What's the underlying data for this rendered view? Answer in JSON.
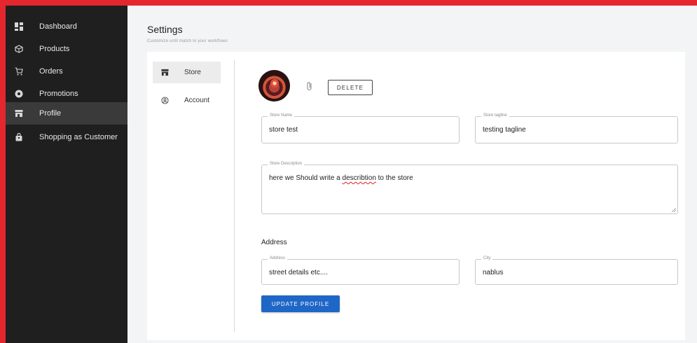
{
  "sidebar": {
    "items": [
      {
        "label": "Dashboard",
        "icon": "dashboard-icon"
      },
      {
        "label": "Products",
        "icon": "box-icon"
      },
      {
        "label": "Orders",
        "icon": "cart-icon"
      },
      {
        "label": "Promotions",
        "icon": "gear-icon"
      },
      {
        "label": "Profile",
        "icon": "store-icon",
        "active": true
      },
      {
        "label": "Shopping as Customer",
        "icon": "bag-icon"
      }
    ]
  },
  "header": {
    "title": "Settings",
    "subtitle": "Customize until match to your workflows"
  },
  "tabs": [
    {
      "label": "Store",
      "icon": "store-icon",
      "active": true
    },
    {
      "label": "Account",
      "icon": "account-icon"
    }
  ],
  "store_form": {
    "delete_label": "DELETE",
    "store_name": {
      "label": "Store Name",
      "value": "store test"
    },
    "store_tagline": {
      "label": "Store tagline",
      "value": "testing tagline"
    },
    "store_description": {
      "label": "Store Description",
      "value_before": "here we Should write a ",
      "value_misspelled": "describtion",
      "value_after": " to the store"
    },
    "address_section": "Address",
    "address": {
      "label": "Address",
      "value": "street details etc...."
    },
    "city": {
      "label": "City",
      "value": "nablus"
    },
    "update_label": "UPDATE PROFILE"
  },
  "colors": {
    "sidebar_bg": "#1f1f1f",
    "sidebar_active": "#3a3a3a",
    "accent": "#1f67c7",
    "outer_border": "#e5262e"
  }
}
